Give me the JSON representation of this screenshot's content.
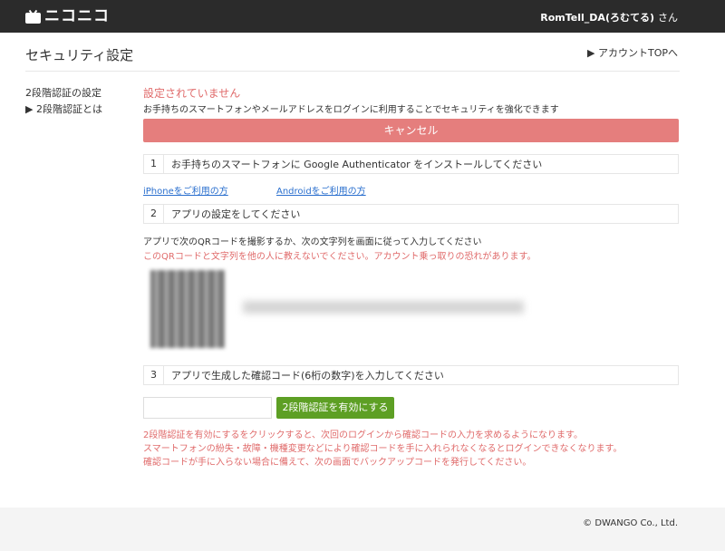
{
  "header": {
    "logo_text": "ニコニコ",
    "username": "RomTell_DA(ろむてる)",
    "honorific": "さん"
  },
  "page": {
    "title": "セキュリティ設定",
    "account_top_link": "▶ アカウントTOPへ"
  },
  "sidebar": {
    "items": [
      {
        "label": "2段階認証の設定"
      },
      {
        "label": "▶ 2段階認証とは"
      }
    ]
  },
  "main": {
    "status": "設定されていません",
    "description": "お手持ちのスマートフォンやメールアドレスをログインに利用することでセキュリティを強化できます",
    "cancel_label": "キャンセル",
    "steps": [
      {
        "num": "1",
        "text": "お手持ちのスマートフォンに Google Authenticator をインストールしてください"
      },
      {
        "num": "2",
        "text": "アプリの設定をしてください"
      },
      {
        "num": "3",
        "text": "アプリで生成した確認コード(6桁の数字)を入力してください"
      }
    ],
    "iphone_link": "iPhoneをご利用の方",
    "android_link": "Androidをご利用の方",
    "qr_instruction": "アプリで次のQRコードを撮影するか、次の文字列を画面に従って入力してください",
    "qr_warning": "このQRコードと文字列を他の人に教えないでください。アカウント乗っ取りの恐れがあります。",
    "code_input_value": "",
    "enable_label": "2段階認証を有効にする",
    "notes": [
      "2段階認証を有効にするをクリックすると、次回のログインから確認コードの入力を求めるようになります。",
      "スマートフォンの紛失・故障・機種変更などにより確認コードを手に入れられなくなるとログインできなくなります。",
      "確認コードが手に入らない場合に備えて、次の画面でバックアップコードを発行してください。"
    ]
  },
  "footer": {
    "copyright": "© DWANGO Co., Ltd."
  },
  "colors": {
    "header_bg": "#2b2b2b",
    "cancel_bg": "#e57e7d",
    "enable_bg": "#5d9f24",
    "warning_text": "#e06b6b",
    "link": "#2a6fce"
  }
}
